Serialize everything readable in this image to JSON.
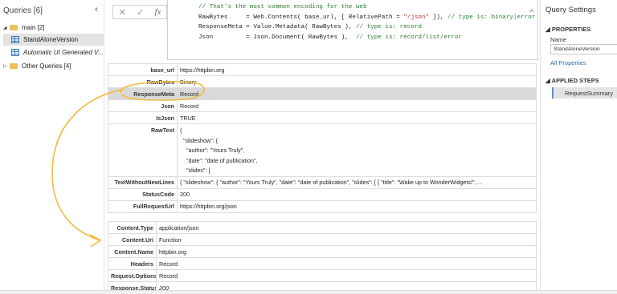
{
  "queries": {
    "title": "Queries [6]",
    "collapse": "‹",
    "items": [
      {
        "label": "main [2]"
      },
      {
        "label": "StandAloneVersion"
      },
      {
        "label": "Automatic UI Generated V..."
      },
      {
        "label": "Other Queries [4]"
      }
    ]
  },
  "toolbar": {
    "cancel": "✕",
    "commit": "✓",
    "fx": "fx"
  },
  "editor": {
    "line1_comment": "// That's the most common encoding for the web",
    "line2_a": "RawBytes     = Web.Contents( base_url, [ RelativePath = ",
    "line2_str": "\"/json\"",
    "line2_b": " ]), ",
    "line2_type": "// type is: binary|error",
    "line3_a": "ResponseMeta = Value.Metadata( RawBytes ), ",
    "line3_type": "// type is: record",
    "line4_a": "Json         = Json.Document( RawBytes ),  ",
    "line4_type": "// type is: record/list/error",
    "chevron": "^"
  },
  "record_main": [
    {
      "key": "base_url",
      "value": "https://httpbin.org"
    },
    {
      "key": "RawBytes",
      "value": "Binary"
    },
    {
      "key": "ResponseMeta",
      "value": "Record"
    },
    {
      "key": "Json",
      "value": "Record"
    },
    {
      "key": "IsJson",
      "value": "TRUE"
    },
    {
      "key": "RawText",
      "value": "{\n  \"slideshow\": {\n    \"author\": \"Yours Truly\",\n    \"date\": \"date of publication\",\n    \"slides\": ["
    },
    {
      "key": "TextWithoutNewLines",
      "value": "{   \"slideshow\": {    \"author\": \"Yours Truly\",    \"date\": \"date of publication\",    \"slides\": [     {      \"title\": \"Wake up to WonderWidgets!\",     ..."
    },
    {
      "key": "StatusCode",
      "value": "200"
    },
    {
      "key": "FullRequestUrl",
      "value": "https://httpbin.org/json"
    }
  ],
  "record_meta": [
    {
      "key": "Content.Type",
      "value": "application/json"
    },
    {
      "key": "Content.Uri",
      "value": "Function"
    },
    {
      "key": "Content.Name",
      "value": "httpbin.org"
    },
    {
      "key": "Headers",
      "value": "Record"
    },
    {
      "key": "Request.Options",
      "value": "Record"
    },
    {
      "key": "Response.Status",
      "value": "200"
    }
  ],
  "settings": {
    "title": "Query Settings",
    "properties": "PROPERTIES",
    "name_label": "Name",
    "name_value": "StandAloneVersion",
    "all_properties": "All Properties",
    "applied_steps": "APPLIED STEPS",
    "step": "RequestSummary"
  },
  "colors": {
    "annotation": "#f5b93c",
    "selected_row": "#d9d9d9",
    "link": "#2b6cb0"
  }
}
